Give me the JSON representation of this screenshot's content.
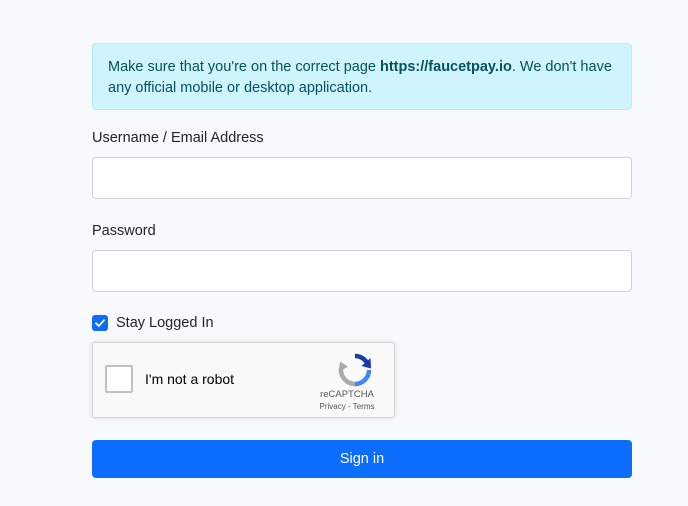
{
  "alert": {
    "text_before": "Make sure that you're on the correct page ",
    "url": "https://faucetpay.io",
    "text_after": ". We don't have any official mobile or desktop application."
  },
  "form": {
    "username_label": "Username / Email Address",
    "username_value": "",
    "password_label": "Password",
    "password_value": "",
    "stay_logged_in_label": "Stay Logged In",
    "stay_logged_in_checked": true,
    "submit_label": "Sign in"
  },
  "recaptcha": {
    "label": "I'm not a robot",
    "brand": "reCAPTCHA",
    "privacy": "Privacy",
    "separator": " - ",
    "terms": "Terms"
  },
  "colors": {
    "primary": "#0d6efd",
    "alert_bg": "#cff4fc",
    "alert_text": "#055160"
  },
  "icons": {
    "checkbox": "check-icon",
    "recaptcha": "recaptcha-logo-icon"
  }
}
